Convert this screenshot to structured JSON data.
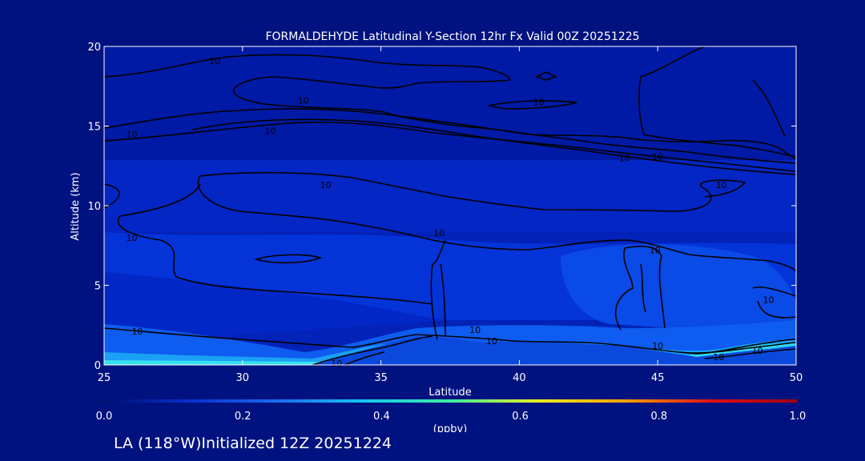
{
  "chart_data": {
    "type": "heatmap",
    "title": "FORMALDEHYDE Latitudinal Y-Section 12hr  Fx Valid 00Z 20251225",
    "xlabel": "Latitude",
    "ylabel": "Altitude (km)",
    "xlim": [
      25,
      50
    ],
    "ylim": [
      0,
      20
    ],
    "x_ticks": [
      "25",
      "30",
      "35",
      "40",
      "45",
      "50"
    ],
    "y_ticks": [
      "0",
      "5",
      "10",
      "15",
      "20"
    ],
    "colorbar": {
      "label": "(ppbv)",
      "range": [
        0,
        1
      ],
      "ticks": [
        "0.0",
        "0.2",
        "0.4",
        "0.6",
        "0.8",
        "1.0"
      ],
      "colors": [
        "#00106e",
        "#0a2fd0",
        "#1a6cf0",
        "#16c8f0",
        "#3cf0a0",
        "#e8f020",
        "#f8a000",
        "#e01010",
        "#a00010"
      ]
    },
    "contour_labels": [
      {
        "text": "10",
        "lat": 29.0,
        "alt": 19.1
      },
      {
        "text": "10",
        "lat": 32.2,
        "alt": 16.6
      },
      {
        "text": "10",
        "lat": 31.0,
        "alt": 14.7
      },
      {
        "text": "10",
        "lat": 26.0,
        "alt": 14.5
      },
      {
        "text": "10",
        "lat": 40.7,
        "alt": 16.5
      },
      {
        "text": "10",
        "lat": 45.0,
        "alt": 13.1
      },
      {
        "text": "10",
        "lat": 43.8,
        "alt": 13.0
      },
      {
        "text": "10",
        "lat": 47.3,
        "alt": 11.3
      },
      {
        "text": "10",
        "lat": 33.0,
        "alt": 11.3
      },
      {
        "text": "10",
        "lat": 26.0,
        "alt": 8.0
      },
      {
        "text": "10",
        "lat": 37.1,
        "alt": 8.3
      },
      {
        "text": "10",
        "lat": 44.9,
        "alt": 7.2
      },
      {
        "text": "10",
        "lat": 26.2,
        "alt": 2.1
      },
      {
        "text": "10",
        "lat": 38.4,
        "alt": 2.2
      },
      {
        "text": "10",
        "lat": 39.0,
        "alt": 1.5
      },
      {
        "text": "10",
        "lat": 49.0,
        "alt": 4.1
      },
      {
        "text": "10",
        "lat": 45.0,
        "alt": 1.2
      },
      {
        "text": "10",
        "lat": 47.2,
        "alt": 0.5
      },
      {
        "text": "10",
        "lat": 48.6,
        "alt": 0.9
      },
      {
        "text": "10",
        "lat": 33.4,
        "alt": 0.1
      }
    ]
  },
  "footer": {
    "text": "LA (118°W)Initialized 12Z 20251224"
  }
}
